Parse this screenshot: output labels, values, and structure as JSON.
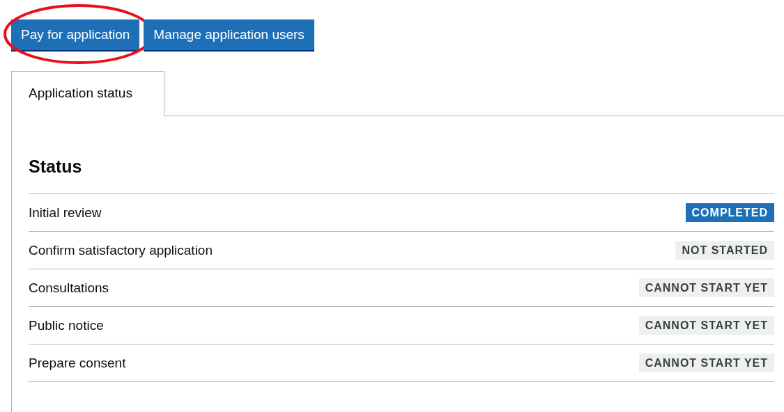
{
  "buttons": [
    {
      "label": "Pay for application",
      "highlighted": true
    },
    {
      "label": "Manage application users",
      "highlighted": false
    }
  ],
  "tabs": [
    {
      "label": "Application status",
      "selected": true
    }
  ],
  "heading": "Status",
  "rows": [
    {
      "name": "Initial review",
      "status": "COMPLETED",
      "kind": "completed"
    },
    {
      "name": "Confirm satisfactory application",
      "status": "NOT STARTED",
      "kind": "pending"
    },
    {
      "name": "Consultations",
      "status": "CANNOT START YET",
      "kind": "pending"
    },
    {
      "name": "Public notice",
      "status": "CANNOT START YET",
      "kind": "pending"
    },
    {
      "name": "Prepare consent",
      "status": "CANNOT START YET",
      "kind": "pending"
    }
  ]
}
